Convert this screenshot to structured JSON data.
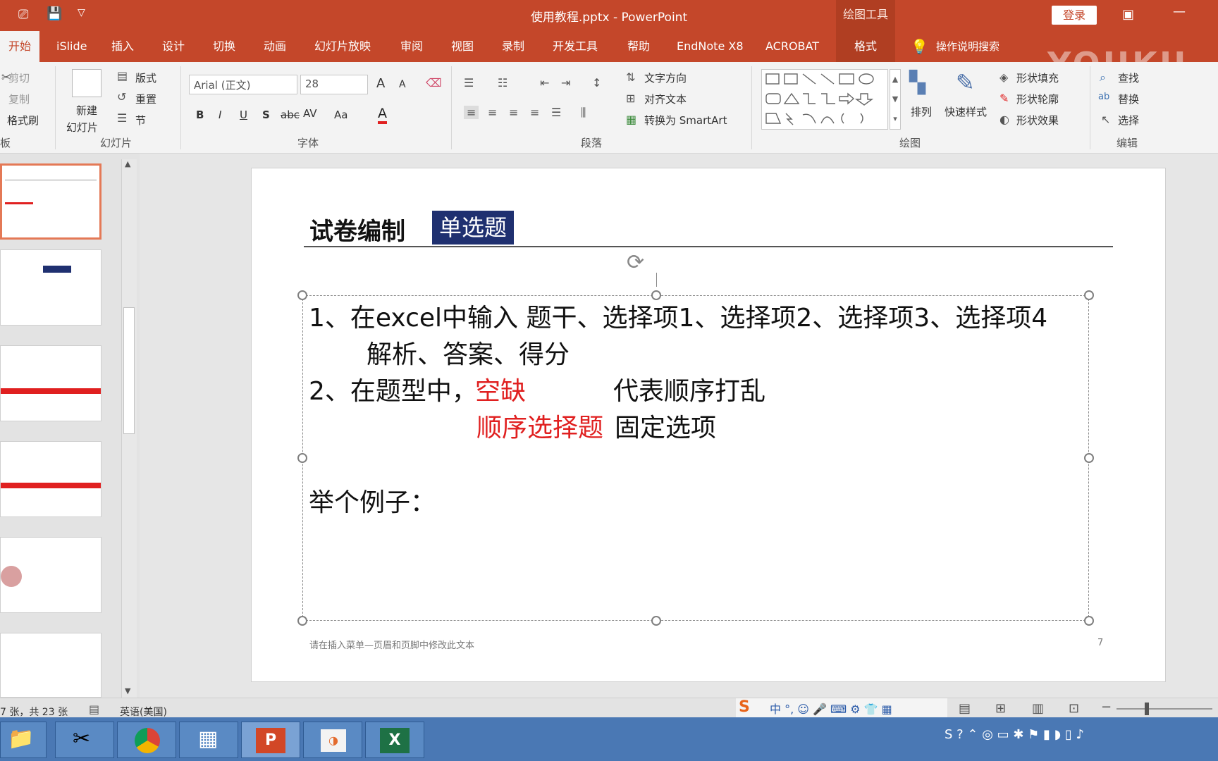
{
  "app": {
    "doc_title": "使用教程.pptx - PowerPoint",
    "drawing_tools": "绘图工具",
    "login": "登录"
  },
  "tabs": [
    {
      "label": "开始"
    },
    {
      "label": "iSlide"
    },
    {
      "label": "插入"
    },
    {
      "label": "设计"
    },
    {
      "label": "切换"
    },
    {
      "label": "动画"
    },
    {
      "label": "幻灯片放映"
    },
    {
      "label": "审阅"
    },
    {
      "label": "视图"
    },
    {
      "label": "录制"
    },
    {
      "label": "开发工具"
    },
    {
      "label": "帮助"
    },
    {
      "label": "EndNote X8"
    },
    {
      "label": "ACROBAT"
    },
    {
      "label": "格式"
    }
  ],
  "tell_me": "操作说明搜索",
  "watermark": "YOUKU",
  "ribbon": {
    "clipboard": {
      "cut": "剪切",
      "copy": "复制",
      "format_painter": "格式刷",
      "group": "板"
    },
    "slides": {
      "new_slide_1": "新建",
      "new_slide_2": "幻灯片",
      "layout": "版式",
      "reset": "重置",
      "section": "节",
      "group": "幻灯片"
    },
    "font": {
      "font_name": "Arial (正文)",
      "font_size": "28",
      "bold": "B",
      "italic": "I",
      "underline": "U",
      "shadow": "S",
      "strike": "abc",
      "spacing": "AV",
      "case": "Aa",
      "color": "A",
      "grow": "A",
      "shrink": "A",
      "group": "字体"
    },
    "paragraph": {
      "text_direction": "文字方向",
      "align_text": "对齐文本",
      "smartart": "转换为 SmartArt",
      "group": "段落"
    },
    "drawing": {
      "arrange": "排列",
      "quick_styles": "快速样式",
      "shape_fill": "形状填充",
      "shape_outline": "形状轮廓",
      "shape_effects": "形状效果",
      "group": "绘图"
    },
    "editing": {
      "find": "查找",
      "replace": "替换",
      "select": "选择",
      "group": "编辑"
    }
  },
  "slide": {
    "title": "试卷编制",
    "badge": "单选题",
    "line1": "1、在excel中输入 题干、选择项1、选择项2、选择项3、选择项4",
    "line1b": "解析、答案、得分",
    "line2_prefix": "2、在题型中，",
    "line2_red": "空缺",
    "line2_desc": "代表顺序打乱",
    "line3_red": "顺序选择题",
    "line3_desc": "固定选项",
    "example": "举个例子：",
    "footer": "请在插入菜单—页眉和页脚中修改此文本",
    "page_number": "7"
  },
  "statusbar": {
    "slide_info": "7 张，共 23 张",
    "language": "英语(美国)"
  },
  "colors": {
    "accent": "#c4472a",
    "badge": "#1f3070",
    "red_text": "#e02020"
  }
}
